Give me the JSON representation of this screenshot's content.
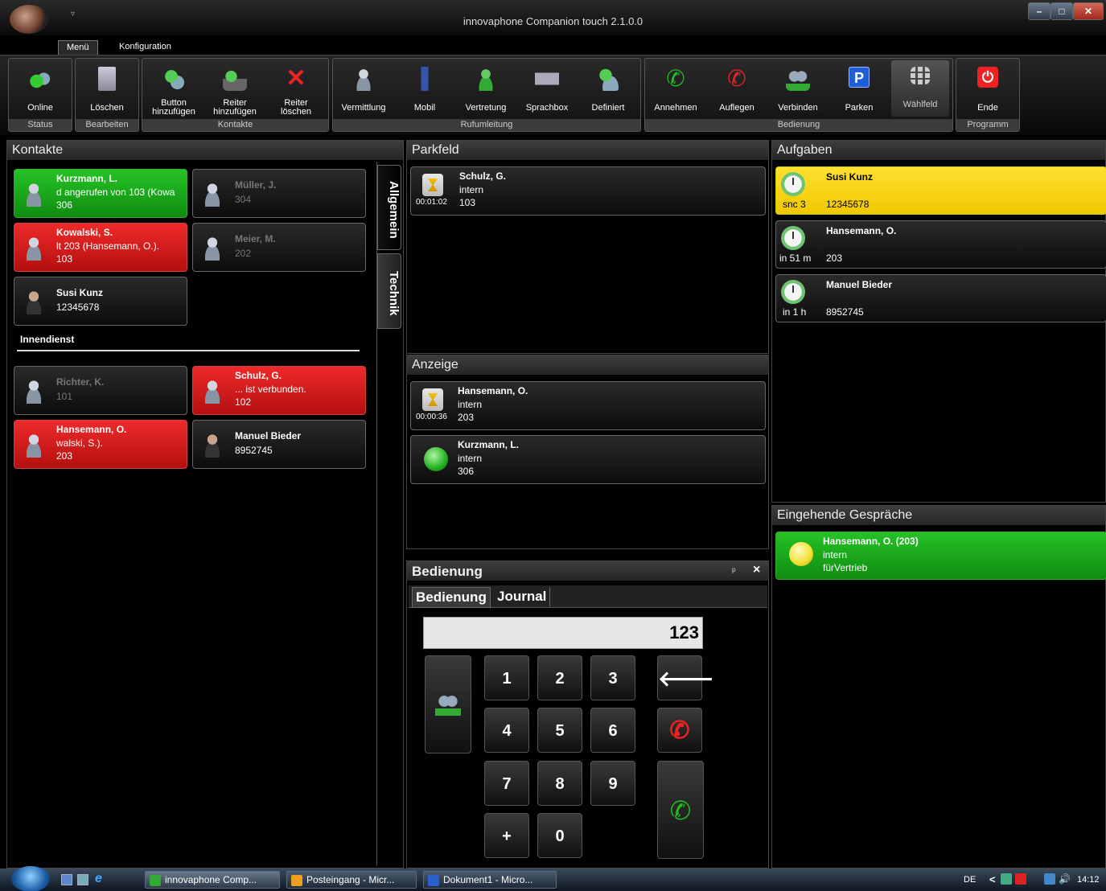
{
  "window": {
    "title": "innovaphone Companion touch 2.1.0.0",
    "qa_arrow": "▿"
  },
  "menu": {
    "tab1": "Menü",
    "tab2": "Konfiguration"
  },
  "ribbon": {
    "status": {
      "label": "Status",
      "online": "Online"
    },
    "bearbeiten": {
      "label": "Bearbeiten",
      "loeschen": "Löschen"
    },
    "kontakte": {
      "label": "Kontakte",
      "button_add_1": "Button",
      "button_add_2": "hinzufügen",
      "reiter_add_1": "Reiter",
      "reiter_add_2": "hinzufügen",
      "reiter_del_1": "Reiter",
      "reiter_del_2": "löschen"
    },
    "rufumleitung": {
      "label": "Rufumleitung",
      "vermittlung": "Vermittlung",
      "mobil": "Mobil",
      "vertretung": "Vertretung",
      "sprachbox": "Sprachbox",
      "definiert": "Definiert"
    },
    "bedienung": {
      "label": "Bedienung",
      "annehmen": "Annehmen",
      "auflegen": "Auflegen",
      "verbinden": "Verbinden",
      "parken": "Parken",
      "waehlfeld": "Wählfeld",
      "parken_glyph": "P"
    },
    "programm": {
      "label": "Programm",
      "ende": "Ende"
    }
  },
  "kontakte": {
    "title": "Kontakte",
    "tabs": [
      "Allgemein",
      "Technik"
    ],
    "cards": [
      {
        "name": "Kurzmann, L.",
        "line2": "d angerufen von 103 (Kowa",
        "line3": "306"
      },
      {
        "name": "Müller, J.",
        "line2": "304",
        "line3": ""
      },
      {
        "name": "Kowalski, S.",
        "line2": "lt 203 (Hansemann, O.).",
        "line3": "103"
      },
      {
        "name": "Meier, M.",
        "line2": "202",
        "line3": ""
      },
      {
        "name": "Susi Kunz",
        "line2": "12345678",
        "line3": ""
      }
    ],
    "section": "Innendienst",
    "section_cards": [
      {
        "name": "Richter, K.",
        "line2": "101"
      },
      {
        "name": "Schulz, G.",
        "line2": "... ist verbunden.",
        "line3": "102"
      },
      {
        "name": "Hansemann, O.",
        "line2": "walski, S.).",
        "line3": "203"
      },
      {
        "name": "Manuel Bieder",
        "line2": "8952745"
      }
    ]
  },
  "parkfeld": {
    "title": "Parkfeld",
    "items": [
      {
        "name": "Schulz, G.",
        "type": "intern",
        "number": "103",
        "timer": "00:01:02"
      }
    ]
  },
  "anzeige": {
    "title": "Anzeige",
    "items": [
      {
        "name": "Hansemann, O.",
        "type": "intern",
        "number": "203",
        "timer": "00:00:36"
      },
      {
        "name": "Kurzmann, L.",
        "type": "intern",
        "number": "306"
      }
    ]
  },
  "aufgaben": {
    "title": "Aufgaben",
    "items": [
      {
        "name": "Susi Kunz",
        "number": "12345678",
        "time": "snc 3"
      },
      {
        "name": "Hansemann, O.",
        "number": "203",
        "time": "in 51 m"
      },
      {
        "name": "Manuel Bieder",
        "number": "8952745",
        "time": "in 1 h"
      }
    ]
  },
  "eingehend": {
    "title": "Eingehende Gespräche",
    "items": [
      {
        "name": "Hansemann, O. (203)",
        "type": "intern",
        "note": "fürVertrieb"
      }
    ]
  },
  "bedienung": {
    "title": "Bedienung",
    "pin": "ᵖ",
    "close": "×",
    "tabs": [
      "Bedienung",
      "Journal"
    ],
    "dial_value": "123",
    "keys": [
      "1",
      "2",
      "3",
      "4",
      "5",
      "6",
      "7",
      "8",
      "9",
      "+",
      "0"
    ],
    "backspace": "🡐"
  },
  "taskbar": {
    "tasks": [
      "innovaphone Comp...",
      "Posteingang - Micr...",
      "Dokument1 - Micro..."
    ],
    "lang": "DE",
    "arrow": "<",
    "clock": "14:12"
  },
  "colors": {
    "green": "#1aa81a",
    "red": "#d41818",
    "yellow": "#f5d400"
  }
}
